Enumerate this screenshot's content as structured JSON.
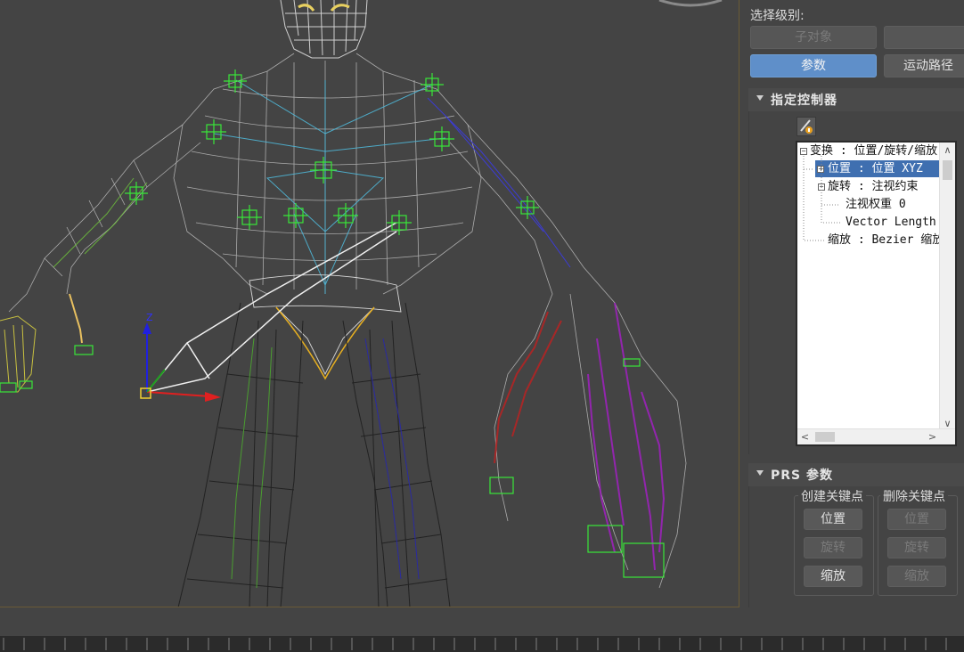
{
  "viewport": {
    "axis_labels": {
      "z": "Z"
    }
  },
  "command_panel": {
    "selection_level_label": "选择级别:",
    "subobject_button": "子对象",
    "blank_button": "",
    "params_button": "参数",
    "trajectory_button": "运动路径",
    "assign_controller": {
      "title": "指定控制器",
      "icon": "assign-controller-icon",
      "tree": [
        {
          "label": "变换 : 位置/旋转/缩放",
          "expander": "minus",
          "selected": false
        },
        {
          "label": "位置 : 位置 XYZ",
          "expander": "plus",
          "selected": true
        },
        {
          "label": "旋转 : 注视约束",
          "expander": "minus",
          "selected": false
        },
        {
          "label": "注视权重 0",
          "expander": "",
          "selected": false
        },
        {
          "label": "Vector Length",
          "expander": "",
          "selected": false
        },
        {
          "label": "缩放 : Bezier 缩放",
          "expander": "",
          "selected": false
        }
      ],
      "scroll_up": "∧",
      "scroll_down": "∨",
      "scroll_left": "<",
      "scroll_right": ">"
    },
    "prs": {
      "title": "PRS 参数",
      "create_key": {
        "title": "创建关键点",
        "position": "位置",
        "rotation": "旋转",
        "scale": "缩放"
      },
      "delete_key": {
        "title": "删除关键点",
        "position": "位置",
        "rotation": "旋转",
        "scale": "缩放"
      }
    }
  },
  "colors": {
    "viewport_bg": "#444444",
    "selected_blue": "#5f8fc9",
    "bone_green": "#39e639",
    "wire_light": "#c8c8c8"
  }
}
